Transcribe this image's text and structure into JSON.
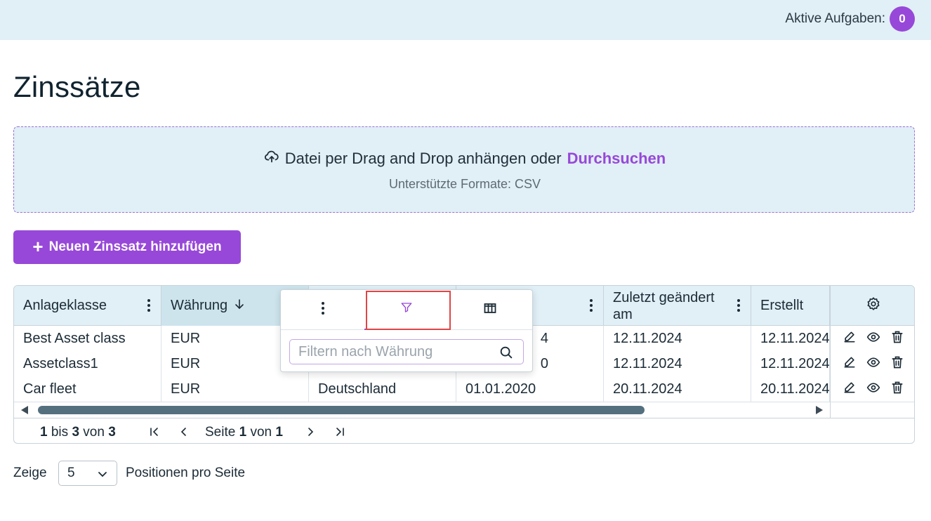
{
  "topbar": {
    "tasks_label": "Aktive Aufgaben:",
    "tasks_count": "0"
  },
  "page": {
    "title": "Zinssätze"
  },
  "dropzone": {
    "text": "Datei per Drag and Drop anhängen oder",
    "link": "Durchsuchen",
    "formats": "Unterstützte Formate: CSV",
    "icon": "upload-cloud-icon"
  },
  "add_button": {
    "label": "Neuen Zinssatz hinzufügen"
  },
  "table": {
    "columns": [
      {
        "label": "Anlageklasse"
      },
      {
        "label": "Währung"
      },
      {
        "label": ""
      },
      {
        "label": ""
      },
      {
        "label": "Zuletzt geändert am"
      },
      {
        "label": "Erstellt"
      }
    ],
    "sort_column": "Währung",
    "sort_direction": "desc",
    "rows": [
      {
        "anlageklasse": "Best Asset class",
        "waehrung": "EUR",
        "land": "",
        "datum": "4",
        "geaendert": "12.11.2024",
        "erstellt": "12.11.2024"
      },
      {
        "anlageklasse": "Assetclass1",
        "waehrung": "EUR",
        "land": "",
        "datum": "0",
        "geaendert": "12.11.2024",
        "erstellt": "12.11.2024"
      },
      {
        "anlageklasse": "Car fleet",
        "waehrung": "EUR",
        "land": "Deutschland",
        "datum": "01.01.2020",
        "geaendert": "20.11.2024",
        "erstellt": "20.11.2024"
      }
    ],
    "row_actions": [
      "edit-icon",
      "eye-icon",
      "trash-icon"
    ],
    "scroll_position": 0.0
  },
  "pagination": {
    "from": "1",
    "from_sep": "bis",
    "to": "3",
    "of_sep": "von",
    "total": "3",
    "page_label": "Seite",
    "page": "1",
    "page_of": "von",
    "pages": "1"
  },
  "column_menu": {
    "active_tab": "filter",
    "tabs": [
      "menu-icon",
      "filter-icon",
      "columns-icon"
    ],
    "filter_placeholder": "Filtern nach Währung",
    "filter_value": ""
  },
  "per_page": {
    "prefix": "Zeige",
    "value": "5",
    "suffix": "Positionen pro Seite"
  },
  "colors": {
    "accent": "#9748d8",
    "header_bg": "#e1eff6",
    "highlight": "#e04545"
  }
}
